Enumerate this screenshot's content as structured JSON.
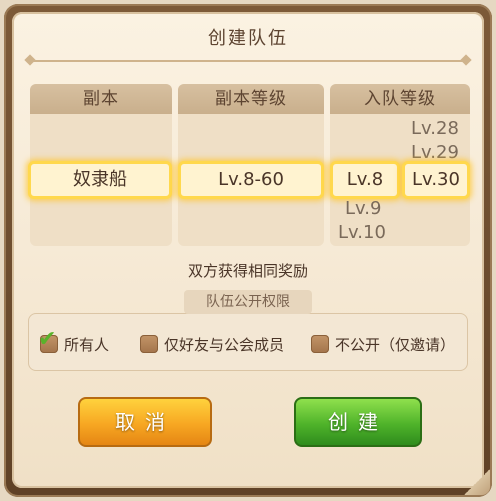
{
  "dialog": {
    "title": "创建队伍"
  },
  "columns": {
    "dungeon": {
      "header": "副本",
      "selected": "奴隶船"
    },
    "dungeon_level": {
      "header": "副本等级",
      "selected": "Lv.8-60"
    },
    "join_level": {
      "header": "入队等级",
      "min": {
        "options_above": [],
        "selected": "Lv.8",
        "options_below": [
          "Lv.9",
          "Lv.10"
        ]
      },
      "max": {
        "options_above": [
          "Lv.28",
          "Lv.29"
        ],
        "selected": "Lv.30",
        "options_below": []
      }
    }
  },
  "reward_text": "双方获得相同奖励",
  "permissions": {
    "header": "队伍公开权限",
    "options": [
      {
        "label": "所有人",
        "checked": true
      },
      {
        "label": "仅好友与公会成员",
        "checked": false
      },
      {
        "label": "不公开（仅邀请）",
        "checked": false
      }
    ]
  },
  "buttons": {
    "cancel": "取消",
    "create": "创建"
  },
  "colors": {
    "cancel_button": "#f7a722",
    "create_button": "#4fb32a",
    "selection_glow": "#ffd84d",
    "checkmark": "#59b22b"
  }
}
